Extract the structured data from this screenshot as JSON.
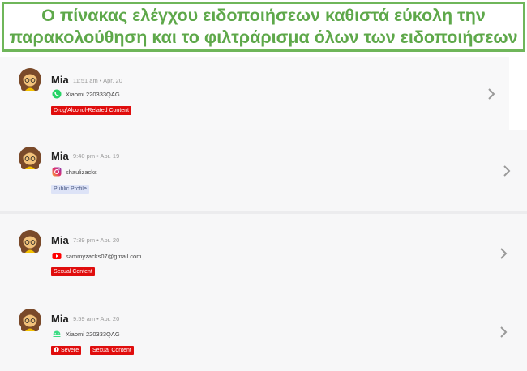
{
  "banner": {
    "line1": "Ο πίνακας ελέγχου ειδοποιήσεων καθιστά εύκολη την",
    "line2": "παρακολούθηση και το φιλτράρισμα όλων των ειδοποιήσεων"
  },
  "alerts": [
    {
      "name": "Mia",
      "time": "11:51 am • Apr. 20",
      "app_icon": "whatsapp-icon",
      "device": "Xiaomi 220333QAG",
      "tags": [
        "Drug/Alcohol-Related Content"
      ]
    },
    {
      "name": "Mia",
      "time": "9:40 pm • Apr. 19",
      "app_icon": "instagram-icon",
      "device": "shaulizacks",
      "tags": [
        "Public Profile"
      ]
    },
    {
      "name": "Mia",
      "time": "7:39 pm • Apr. 20",
      "app_icon": "youtube-icon",
      "device": "sammyzacks07@gmail.com",
      "tags": [
        "Sexual Content"
      ]
    },
    {
      "name": "Mia",
      "time": "9:59 am • Apr. 20",
      "app_icon": "android-icon",
      "device": "Xiaomi 220333QAG",
      "tags": [
        "Severe",
        "Sexual Content"
      ]
    }
  ],
  "colors": {
    "banner_green": "#5ea84a",
    "tag_red": "#e00d0d",
    "tag_blue_bg": "#dde3f7"
  }
}
